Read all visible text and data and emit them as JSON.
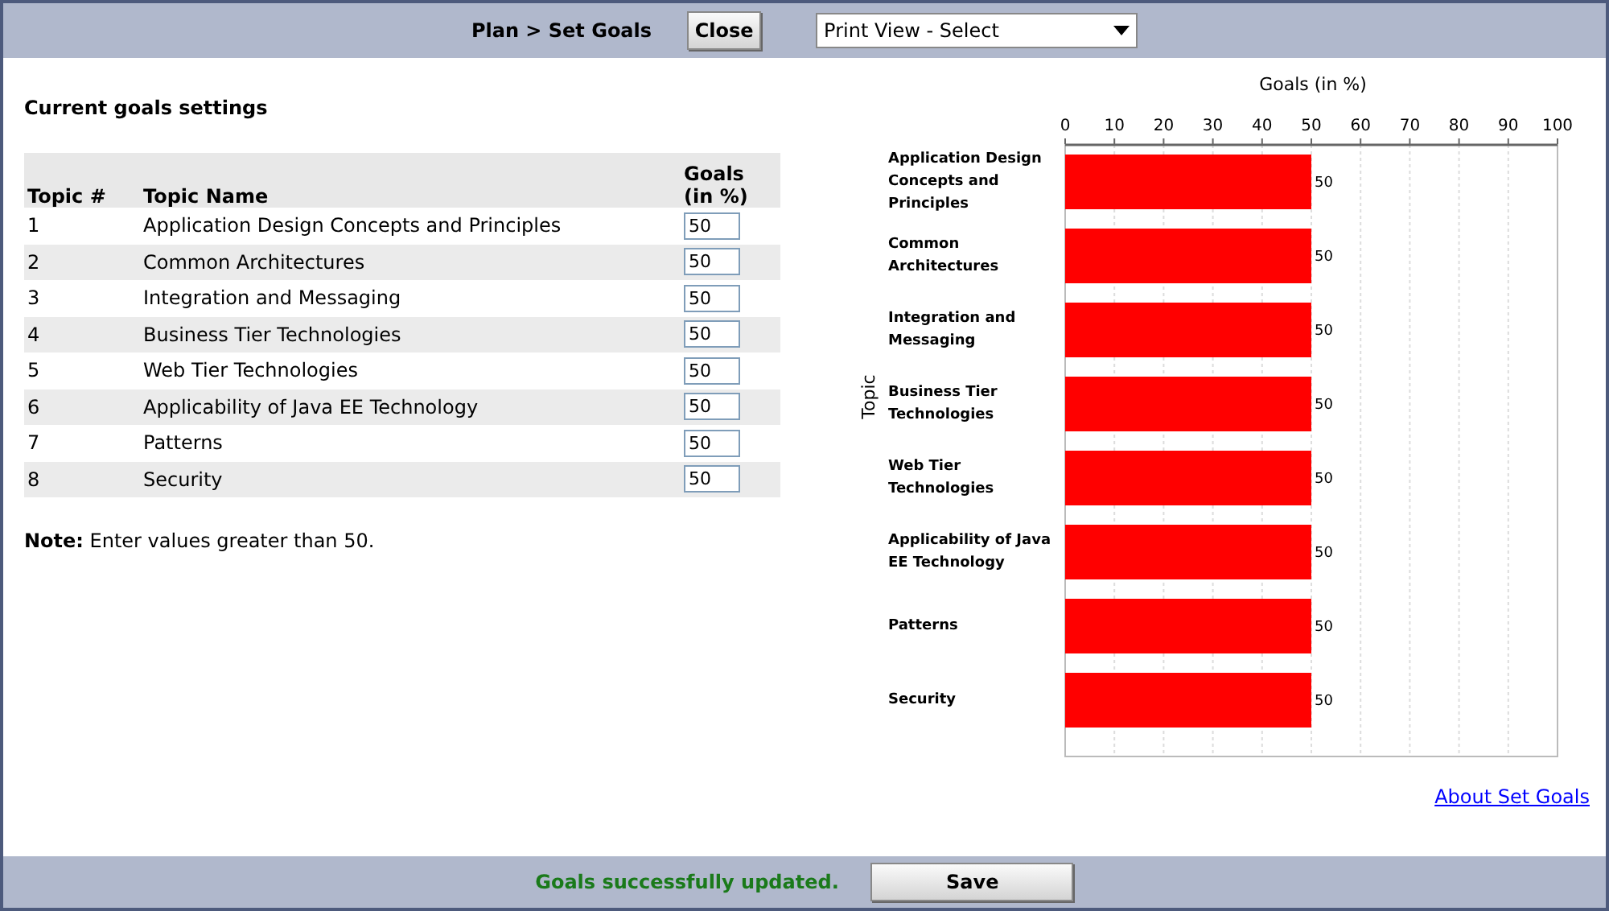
{
  "header": {
    "breadcrumb": "Plan > Set Goals",
    "close_button": "Close",
    "print_view_select": "Print View - Select"
  },
  "section_title": "Current goals settings",
  "table": {
    "columns": [
      "Topic #",
      "Topic Name",
      "Goals (in %)"
    ],
    "rows": [
      {
        "number": "1",
        "name": "Application Design Concepts and Principles",
        "goal": "50"
      },
      {
        "number": "2",
        "name": "Common Architectures",
        "goal": "50"
      },
      {
        "number": "3",
        "name": "Integration and Messaging",
        "goal": "50"
      },
      {
        "number": "4",
        "name": "Business Tier Technologies",
        "goal": "50"
      },
      {
        "number": "5",
        "name": "Web Tier Technologies",
        "goal": "50"
      },
      {
        "number": "6",
        "name": "Applicability of Java EE Technology",
        "goal": "50"
      },
      {
        "number": "7",
        "name": "Patterns",
        "goal": "50"
      },
      {
        "number": "8",
        "name": "Security",
        "goal": "50"
      }
    ]
  },
  "note": "**Note:** Enter values greater than 50.",
  "chart_data": {
    "type": "bar",
    "orientation": "horizontal",
    "xlabel": "Goals (in %)",
    "ylabel": "Topic",
    "categories": [
      "Application Design Concepts and Principles",
      "Common Architectures",
      "Integration and Messaging",
      "Business Tier Technologies",
      "Web Tier Technologies",
      "Applicability of Java EE Technology",
      "Patterns",
      "Security"
    ],
    "series": [
      {
        "color": "#ff0000",
        "values": [
          50,
          50,
          50,
          50,
          50,
          50,
          50,
          50
        ]
      }
    ],
    "grid": true,
    "xlim": [
      0,
      100
    ],
    "xticks": [
      0,
      10,
      20,
      30,
      40,
      50,
      60,
      70,
      80,
      90,
      100
    ],
    "data_labels": true
  },
  "about_link": "About Set Goals",
  "footer": {
    "status": "Goals successfully updated.",
    "save_button": "Save"
  }
}
